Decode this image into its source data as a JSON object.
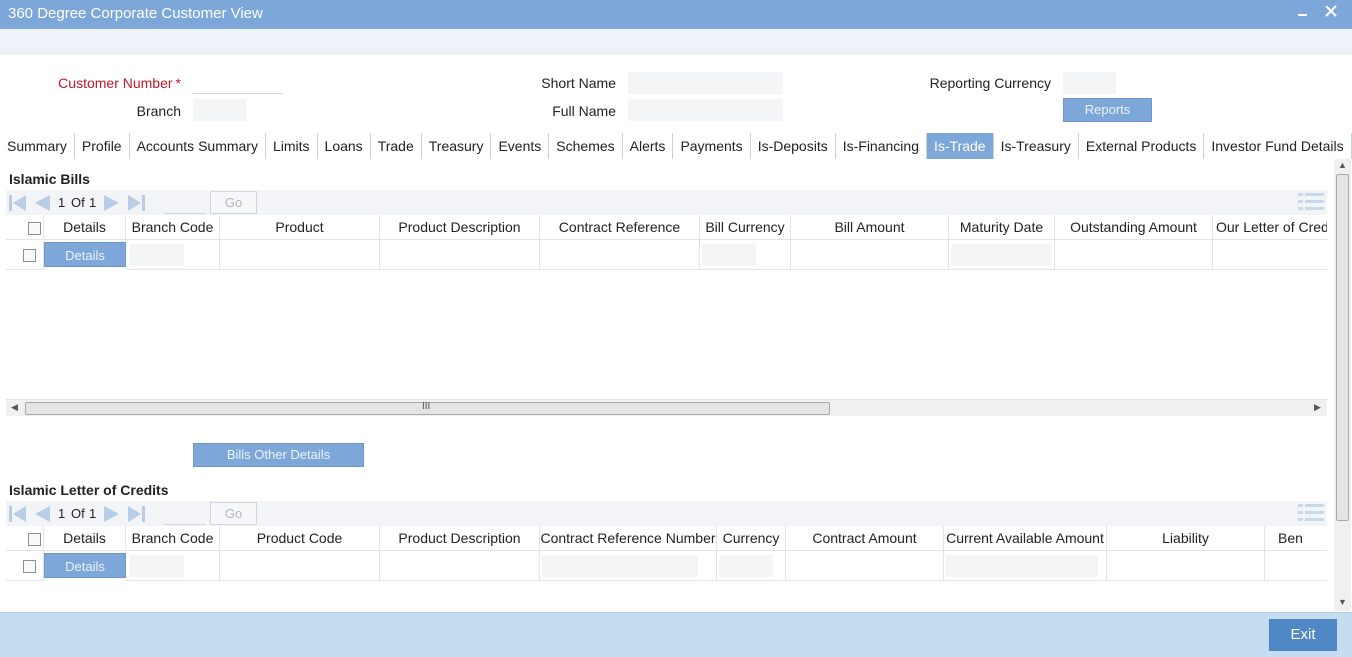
{
  "window": {
    "title": "360 Degree Corporate Customer View",
    "minimize_icon": "minimize-icon",
    "close_icon": "close-icon"
  },
  "header": {
    "customer_number_label": "Customer Number",
    "required_marker": "*",
    "customer_number_value": "",
    "branch_label": "Branch",
    "branch_value": "",
    "short_name_label": "Short Name",
    "short_name_value": "",
    "full_name_label": "Full Name",
    "full_name_value": "",
    "reporting_currency_label": "Reporting Currency",
    "reporting_currency_value": "",
    "reports_button": "Reports"
  },
  "tabs": [
    {
      "label": "Summary"
    },
    {
      "label": "Profile"
    },
    {
      "label": "Accounts Summary"
    },
    {
      "label": "Limits"
    },
    {
      "label": "Loans"
    },
    {
      "label": "Trade"
    },
    {
      "label": "Treasury"
    },
    {
      "label": "Events"
    },
    {
      "label": "Schemes"
    },
    {
      "label": "Alerts"
    },
    {
      "label": "Payments"
    },
    {
      "label": "Is-Deposits"
    },
    {
      "label": "Is-Financing"
    },
    {
      "label": "Is-Trade"
    },
    {
      "label": "Is-Treasury"
    },
    {
      "label": "External Products"
    },
    {
      "label": "Investor Fund Details"
    }
  ],
  "active_tab": "Is-Trade",
  "bills": {
    "title": "Islamic Bills",
    "page_current": "1",
    "page_of": "Of",
    "page_total": "1",
    "go_label": "Go",
    "columns": [
      "Details",
      "Branch Code",
      "Product",
      "Product Description",
      "Contract Reference",
      "Bill Currency",
      "Bill Amount",
      "Maturity Date",
      "Outstanding Amount",
      "Our Letter of Credit"
    ],
    "row_details_button": "Details",
    "other_details_button": "Bills Other Details"
  },
  "letters_of_credit": {
    "title": "Islamic Letter of Credits",
    "page_current": "1",
    "page_of": "Of",
    "page_total": "1",
    "go_label": "Go",
    "columns": [
      "Details",
      "Branch Code",
      "Product Code",
      "Product Description",
      "Contract Reference Number",
      "Currency",
      "Contract Amount",
      "Current Available Amount",
      "Liability",
      "Ben"
    ],
    "row_details_button": "Details"
  },
  "scrollbar": {
    "grip": "III"
  },
  "footer": {
    "exit_button": "Exit"
  },
  "colors": {
    "accent": "#7da7d9",
    "footer": "#c6dcf0",
    "exit": "#4f88c4",
    "required": "#c0172a"
  }
}
